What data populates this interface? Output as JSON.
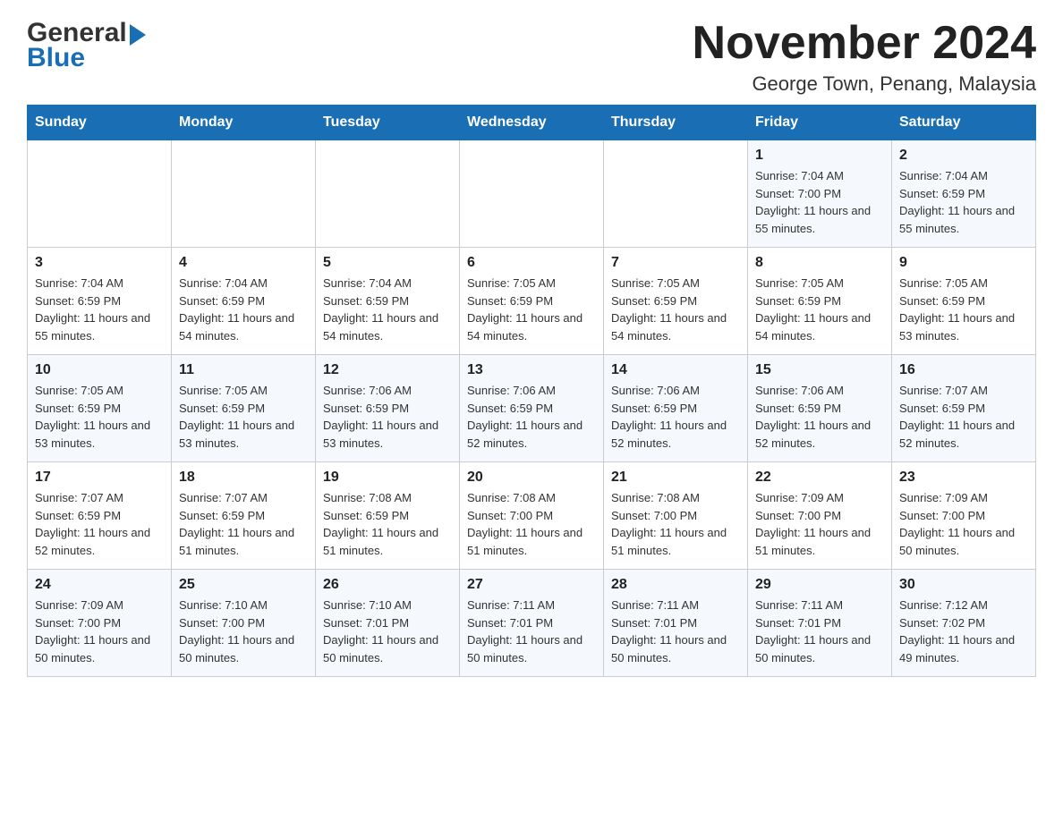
{
  "header": {
    "logo_general": "General",
    "logo_blue": "Blue",
    "title": "November 2024",
    "subtitle": "George Town, Penang, Malaysia"
  },
  "weekdays": [
    "Sunday",
    "Monday",
    "Tuesday",
    "Wednesday",
    "Thursday",
    "Friday",
    "Saturday"
  ],
  "weeks": [
    [
      {
        "day": "",
        "info": ""
      },
      {
        "day": "",
        "info": ""
      },
      {
        "day": "",
        "info": ""
      },
      {
        "day": "",
        "info": ""
      },
      {
        "day": "",
        "info": ""
      },
      {
        "day": "1",
        "info": "Sunrise: 7:04 AM\nSunset: 7:00 PM\nDaylight: 11 hours and 55 minutes."
      },
      {
        "day": "2",
        "info": "Sunrise: 7:04 AM\nSunset: 6:59 PM\nDaylight: 11 hours and 55 minutes."
      }
    ],
    [
      {
        "day": "3",
        "info": "Sunrise: 7:04 AM\nSunset: 6:59 PM\nDaylight: 11 hours and 55 minutes."
      },
      {
        "day": "4",
        "info": "Sunrise: 7:04 AM\nSunset: 6:59 PM\nDaylight: 11 hours and 54 minutes."
      },
      {
        "day": "5",
        "info": "Sunrise: 7:04 AM\nSunset: 6:59 PM\nDaylight: 11 hours and 54 minutes."
      },
      {
        "day": "6",
        "info": "Sunrise: 7:05 AM\nSunset: 6:59 PM\nDaylight: 11 hours and 54 minutes."
      },
      {
        "day": "7",
        "info": "Sunrise: 7:05 AM\nSunset: 6:59 PM\nDaylight: 11 hours and 54 minutes."
      },
      {
        "day": "8",
        "info": "Sunrise: 7:05 AM\nSunset: 6:59 PM\nDaylight: 11 hours and 54 minutes."
      },
      {
        "day": "9",
        "info": "Sunrise: 7:05 AM\nSunset: 6:59 PM\nDaylight: 11 hours and 53 minutes."
      }
    ],
    [
      {
        "day": "10",
        "info": "Sunrise: 7:05 AM\nSunset: 6:59 PM\nDaylight: 11 hours and 53 minutes."
      },
      {
        "day": "11",
        "info": "Sunrise: 7:05 AM\nSunset: 6:59 PM\nDaylight: 11 hours and 53 minutes."
      },
      {
        "day": "12",
        "info": "Sunrise: 7:06 AM\nSunset: 6:59 PM\nDaylight: 11 hours and 53 minutes."
      },
      {
        "day": "13",
        "info": "Sunrise: 7:06 AM\nSunset: 6:59 PM\nDaylight: 11 hours and 52 minutes."
      },
      {
        "day": "14",
        "info": "Sunrise: 7:06 AM\nSunset: 6:59 PM\nDaylight: 11 hours and 52 minutes."
      },
      {
        "day": "15",
        "info": "Sunrise: 7:06 AM\nSunset: 6:59 PM\nDaylight: 11 hours and 52 minutes."
      },
      {
        "day": "16",
        "info": "Sunrise: 7:07 AM\nSunset: 6:59 PM\nDaylight: 11 hours and 52 minutes."
      }
    ],
    [
      {
        "day": "17",
        "info": "Sunrise: 7:07 AM\nSunset: 6:59 PM\nDaylight: 11 hours and 52 minutes."
      },
      {
        "day": "18",
        "info": "Sunrise: 7:07 AM\nSunset: 6:59 PM\nDaylight: 11 hours and 51 minutes."
      },
      {
        "day": "19",
        "info": "Sunrise: 7:08 AM\nSunset: 6:59 PM\nDaylight: 11 hours and 51 minutes."
      },
      {
        "day": "20",
        "info": "Sunrise: 7:08 AM\nSunset: 7:00 PM\nDaylight: 11 hours and 51 minutes."
      },
      {
        "day": "21",
        "info": "Sunrise: 7:08 AM\nSunset: 7:00 PM\nDaylight: 11 hours and 51 minutes."
      },
      {
        "day": "22",
        "info": "Sunrise: 7:09 AM\nSunset: 7:00 PM\nDaylight: 11 hours and 51 minutes."
      },
      {
        "day": "23",
        "info": "Sunrise: 7:09 AM\nSunset: 7:00 PM\nDaylight: 11 hours and 50 minutes."
      }
    ],
    [
      {
        "day": "24",
        "info": "Sunrise: 7:09 AM\nSunset: 7:00 PM\nDaylight: 11 hours and 50 minutes."
      },
      {
        "day": "25",
        "info": "Sunrise: 7:10 AM\nSunset: 7:00 PM\nDaylight: 11 hours and 50 minutes."
      },
      {
        "day": "26",
        "info": "Sunrise: 7:10 AM\nSunset: 7:01 PM\nDaylight: 11 hours and 50 minutes."
      },
      {
        "day": "27",
        "info": "Sunrise: 7:11 AM\nSunset: 7:01 PM\nDaylight: 11 hours and 50 minutes."
      },
      {
        "day": "28",
        "info": "Sunrise: 7:11 AM\nSunset: 7:01 PM\nDaylight: 11 hours and 50 minutes."
      },
      {
        "day": "29",
        "info": "Sunrise: 7:11 AM\nSunset: 7:01 PM\nDaylight: 11 hours and 50 minutes."
      },
      {
        "day": "30",
        "info": "Sunrise: 7:12 AM\nSunset: 7:02 PM\nDaylight: 11 hours and 49 minutes."
      }
    ]
  ]
}
